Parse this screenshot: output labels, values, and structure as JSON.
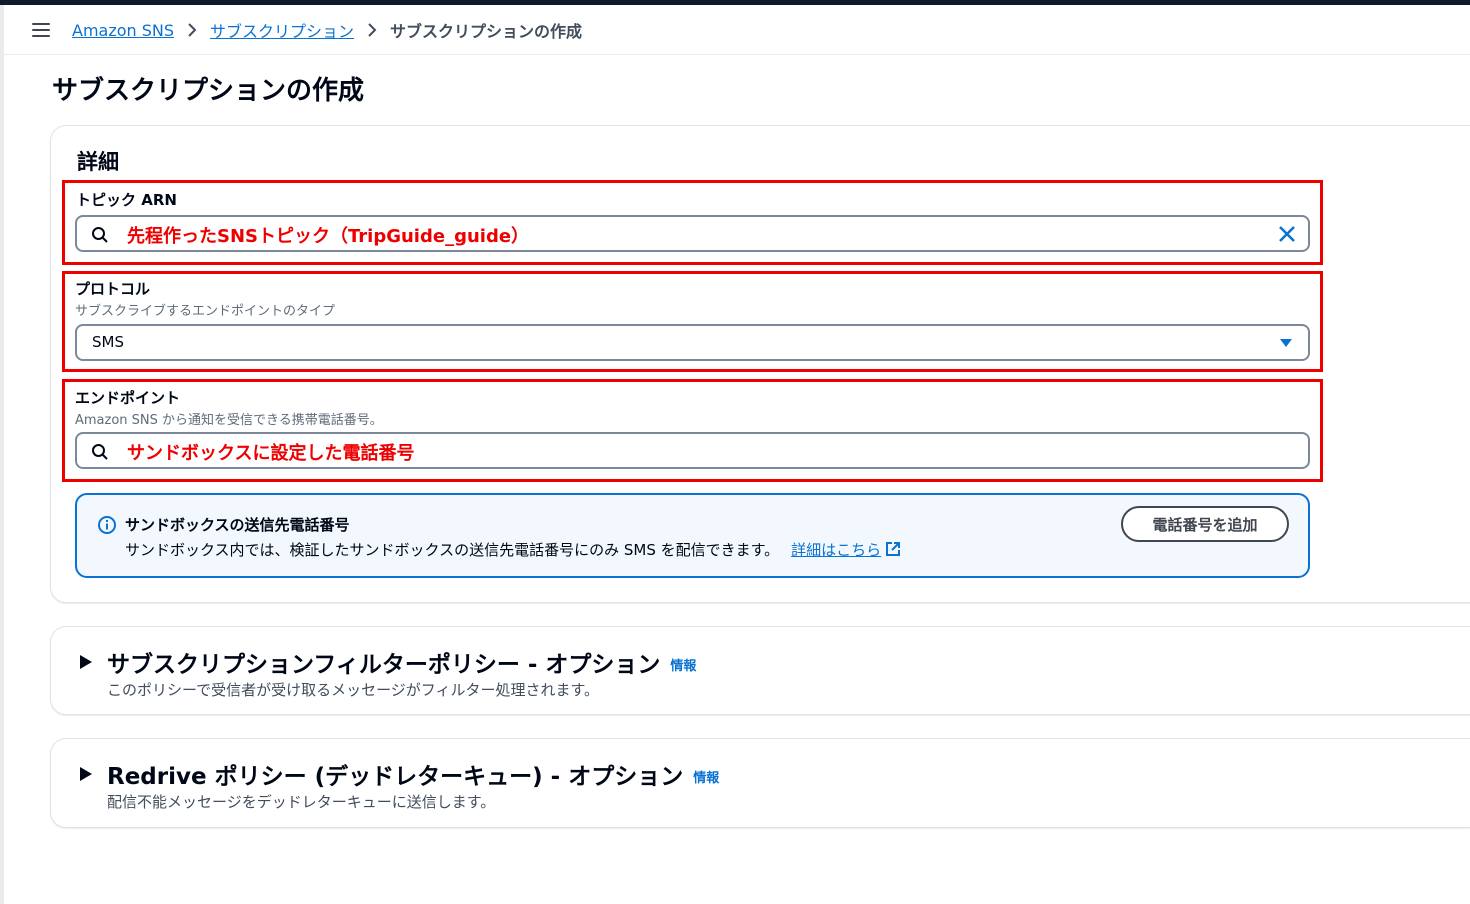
{
  "breadcrumb": {
    "items": [
      "Amazon SNS",
      "サブスクリプション"
    ],
    "current": "サブスクリプションの作成"
  },
  "page": {
    "title": "サブスクリプションの作成"
  },
  "details": {
    "title": "詳細",
    "topic_arn": {
      "label": "トピック ARN",
      "annotation": "先程作ったSNSトピック（TripGuide_guide）"
    },
    "protocol": {
      "label": "プロトコル",
      "description": "サブスクライブするエンドポイントのタイプ",
      "value": "SMS"
    },
    "endpoint": {
      "label": "エンドポイント",
      "description": "Amazon SNS から通知を受信できる携帯電話番号。",
      "annotation": "サンドボックスに設定した電話番号"
    },
    "info": {
      "title": "サンドボックスの送信先電話番号",
      "text": "サンドボックス内では、検証したサンドボックスの送信先電話番号にのみ SMS を配信できます。",
      "link": "詳細はこちら",
      "button": "電話番号を追加"
    }
  },
  "sections": [
    {
      "title": "サブスクリプションフィルターポリシー - オプション",
      "info": "情報",
      "description": "このポリシーで受信者が受け取るメッセージがフィルター処理されます。"
    },
    {
      "title": "Redrive ポリシー (デッドレターキュー) - オプション",
      "info": "情報",
      "description": "配信不能メッセージをデッドレターキューに送信します。"
    }
  ],
  "colors": {
    "link": "#0972d3",
    "annotation": "#ee0000",
    "info_bg": "#f2f8fd"
  }
}
